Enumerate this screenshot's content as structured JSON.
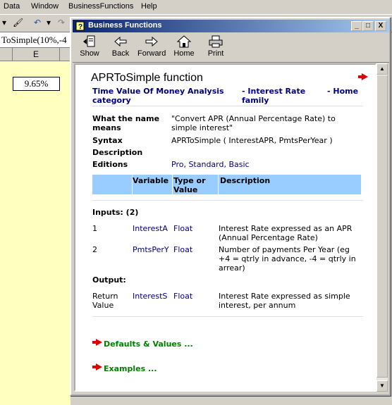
{
  "excel": {
    "menu": [
      "Data",
      "Window",
      "BusinessFunctions",
      "Help"
    ],
    "formula_text": "ToSimple(10%,-4",
    "column_header": "E",
    "cell_value": "9.65%"
  },
  "window": {
    "title": "Business Functions",
    "buttons": {
      "minimize": "_",
      "maximize": "□",
      "close": "X"
    }
  },
  "toolbar": [
    {
      "label": "Show",
      "icon": "show-icon"
    },
    {
      "label": "Back",
      "icon": "back-arrow-icon"
    },
    {
      "label": "Forward",
      "icon": "forward-arrow-icon"
    },
    {
      "label": "Home",
      "icon": "home-icon"
    },
    {
      "label": "Print",
      "icon": "printer-icon"
    }
  ],
  "page": {
    "title": "APRToSimple function",
    "nav": {
      "category": "Time Value Of Money Analysis category",
      "family": "- Interest Rate family",
      "home": "- Home"
    },
    "meaning_label": "What the name means",
    "meaning_value": "\"Convert APR (Annual Percentage Rate) to simple interest\"",
    "syntax_label": "Syntax",
    "syntax_value": "APRToSimple ( InterestAPR, PmtsPerYear )",
    "description_label": "Description",
    "editions_label": "Editions",
    "editions_value": "Pro, Standard, Basic",
    "table_headers": [
      "Variable",
      "Type or Value",
      "Description"
    ],
    "inputs_label": "Inputs: (2)",
    "inputs": [
      {
        "num": "1",
        "var": "InterestA",
        "type": "Float",
        "desc": "Interest Rate expressed as an APR (Annual Percentage Rate)"
      },
      {
        "num": "2",
        "var": "PmtsPerY",
        "type": "Float",
        "desc": "Number of payments Per Year (eg +4 = qtrly in advance, -4 = qtrly in arrear)"
      }
    ],
    "output_label": "Output:",
    "output": {
      "num": "Return Value",
      "var": "InterestS",
      "type": "Float",
      "desc": "Interest Rate expressed as simple interest, per annum"
    },
    "links": [
      "Defaults & Values ...",
      "Examples ..."
    ]
  },
  "colors": {
    "title_start": "#0a246a",
    "title_end": "#a6caf0",
    "link": "#000080",
    "header_bg": "#99ccff",
    "green_link": "#008000",
    "arrow": "#e00000",
    "sheet_bg": "#ffffc0"
  }
}
